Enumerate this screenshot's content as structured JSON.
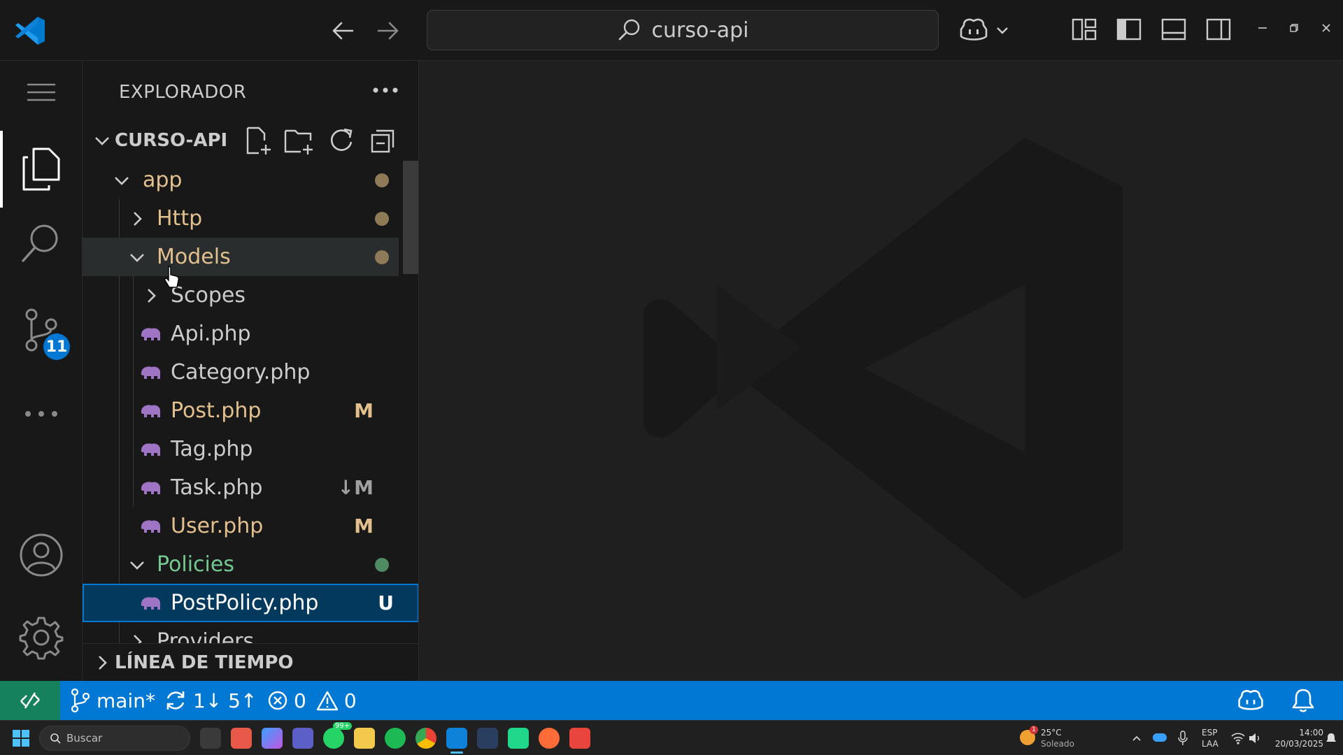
{
  "titlebar": {
    "search_text": "curso-api",
    "icons": [
      "vscode-logo",
      "back-arrow",
      "forward-arrow",
      "search-icon",
      "copilot-icon",
      "chevron-down",
      "customize-layout",
      "toggle-primary-sidebar",
      "toggle-panel",
      "toggle-secondary-sidebar",
      "minimize",
      "restore",
      "close"
    ]
  },
  "activitybar": {
    "items": [
      "menu",
      "explorer",
      "search",
      "source-control",
      "more",
      "accounts",
      "manage"
    ],
    "source_control_badge": "11"
  },
  "sidebar": {
    "title": "EXPLORADOR",
    "workspace": "CURSO-API",
    "tree": [
      {
        "label": "app",
        "kind": "folder",
        "expanded": true,
        "depth": 0
      },
      {
        "label": "Http",
        "kind": "folder",
        "expanded": false,
        "depth": 1
      },
      {
        "label": "Models",
        "kind": "folder",
        "expanded": true,
        "depth": 1
      },
      {
        "label": "Scopes",
        "kind": "folder",
        "expanded": false,
        "depth": 2
      },
      {
        "label": "Api.php",
        "kind": "file",
        "depth": 2,
        "status": ""
      },
      {
        "label": "Category.php",
        "kind": "file",
        "depth": 2,
        "status": ""
      },
      {
        "label": "Post.php",
        "kind": "file",
        "depth": 2,
        "status": "M"
      },
      {
        "label": "Tag.php",
        "kind": "file",
        "depth": 2,
        "status": ""
      },
      {
        "label": "Task.php",
        "kind": "file",
        "depth": 2,
        "status": "↓M"
      },
      {
        "label": "User.php",
        "kind": "file",
        "depth": 2,
        "status": "M"
      },
      {
        "label": "Policies",
        "kind": "folder",
        "expanded": true,
        "depth": 1
      },
      {
        "label": "PostPolicy.php",
        "kind": "file",
        "depth": 2,
        "status": "U"
      },
      {
        "label": "Providers",
        "kind": "folder",
        "expanded": false,
        "depth": 1
      }
    ],
    "timeline_title": "LÍNEA DE TIEMPO"
  },
  "statusbar": {
    "branch": "main*",
    "sync": "1↓ 5↑",
    "errors": "0",
    "warnings": "0"
  },
  "taskbar": {
    "search_placeholder": "Buscar",
    "weather_temp": "25°C",
    "weather_desc": "Soleado",
    "weather_badge": "1",
    "lang_line1": "ESP",
    "lang_line2": "LAA",
    "time": "14:00",
    "date": "20/03/2025",
    "whatsapp_badge": "99+"
  },
  "colors": {
    "accent": "#0078d4",
    "remote": "#16825d",
    "modified": "#e2c08d",
    "untracked": "#73c991",
    "php_icon": "#a074c4",
    "folder_mod": "#d7ba7d",
    "folder_policies": "#73c991"
  }
}
